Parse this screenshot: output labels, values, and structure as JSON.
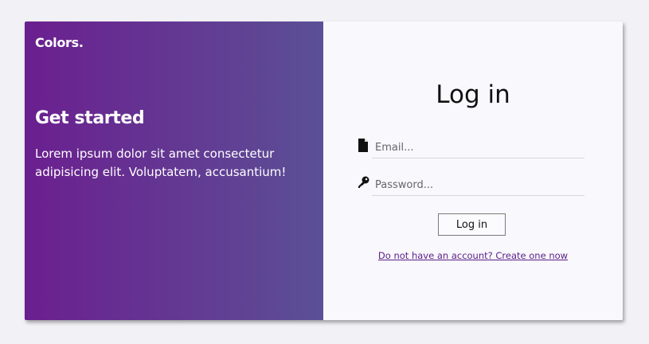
{
  "brand": {
    "name": "Colors."
  },
  "hero": {
    "title": "Get started",
    "body": "Lorem ipsum dolor sit amet consectetur adipisicing elit. Voluptatem, accusantium!"
  },
  "login": {
    "title": "Log in",
    "email": {
      "placeholder": "Email...",
      "value": "",
      "icon": "file-icon"
    },
    "password": {
      "placeholder": "Password...",
      "value": "",
      "icon": "key-icon"
    },
    "submit_label": "Log in",
    "signup_link": "Do not have an account? Create one now"
  },
  "colors": {
    "gradient_start": "#6b1f8f",
    "gradient_end": "#5b5096",
    "form_background": "#f9f8fd",
    "link": "#5a1f87"
  }
}
